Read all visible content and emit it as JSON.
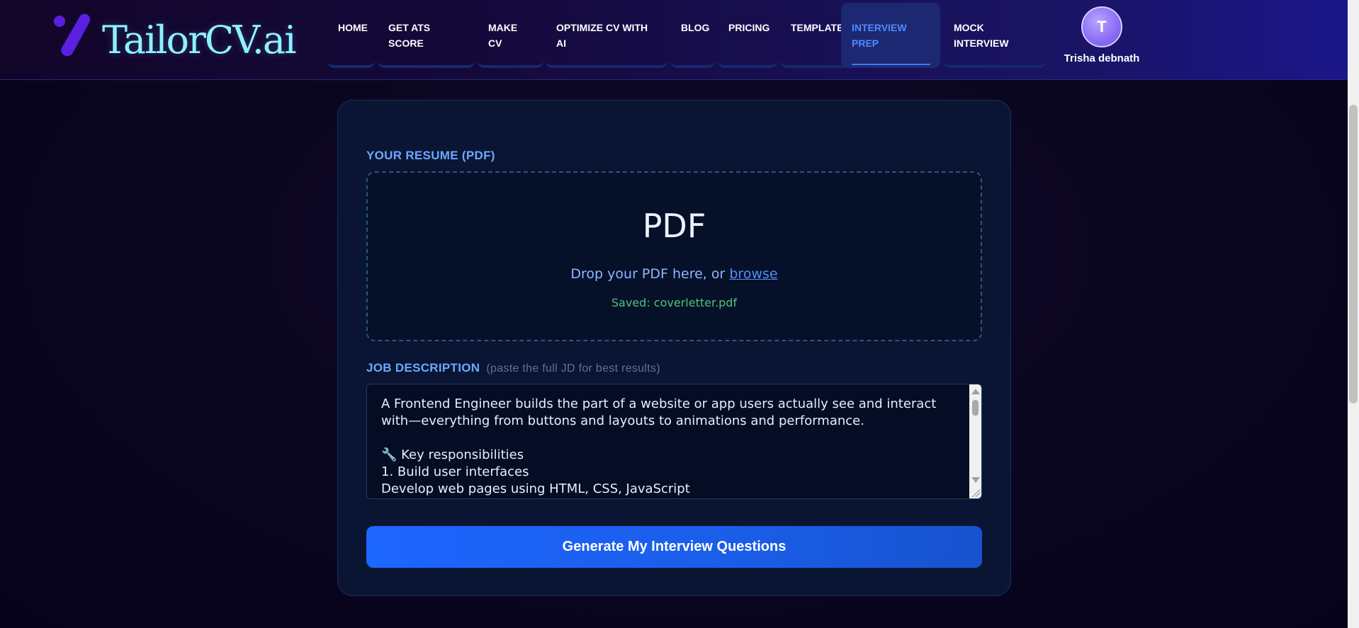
{
  "brand": {
    "name": "TailorCV.ai",
    "logo_icon": "slash-dot-logo"
  },
  "nav": {
    "items": [
      {
        "id": "home",
        "label": "HOME"
      },
      {
        "id": "ats",
        "label": "GET ATS SCORE"
      },
      {
        "id": "make",
        "label": "MAKE CV"
      },
      {
        "id": "optimize",
        "label": "OPTIMIZE CV WITH AI"
      },
      {
        "id": "blog",
        "label": "BLOG"
      },
      {
        "id": "pricing",
        "label": "PRICING"
      },
      {
        "id": "templates",
        "label": "TEMPLATES"
      },
      {
        "id": "interview",
        "label": "INTERVIEW PREP",
        "active": true
      },
      {
        "id": "mock",
        "label": "MOCK INTERVIEW"
      }
    ]
  },
  "user": {
    "initial": "T",
    "name": "Trisha debnath"
  },
  "resume": {
    "label": "YOUR RESUME (PDF)",
    "big_text": "PDF",
    "drop_text": "Drop your PDF here, or",
    "browse_label": "browse",
    "saved_text": "Saved: coverletter.pdf"
  },
  "job_description": {
    "label": "JOB DESCRIPTION",
    "hint": "(paste the full JD for best results)",
    "value": "A Frontend Engineer builds the part of a website or app users actually see and interact with—everything from buttons and layouts to animations and performance.\n\n🔧 Key responsibilities\n1. Build user interfaces\nDevelop web pages using HTML, CSS, JavaScript"
  },
  "cta": {
    "label": "Generate My Interview Questions"
  },
  "colors": {
    "accent": "#1d66ff",
    "label_blue": "#6ea8ff",
    "success_green": "#4fc27d",
    "logo_cyan": "#8ff0ff",
    "logo_purple": "#5b1fe0"
  }
}
